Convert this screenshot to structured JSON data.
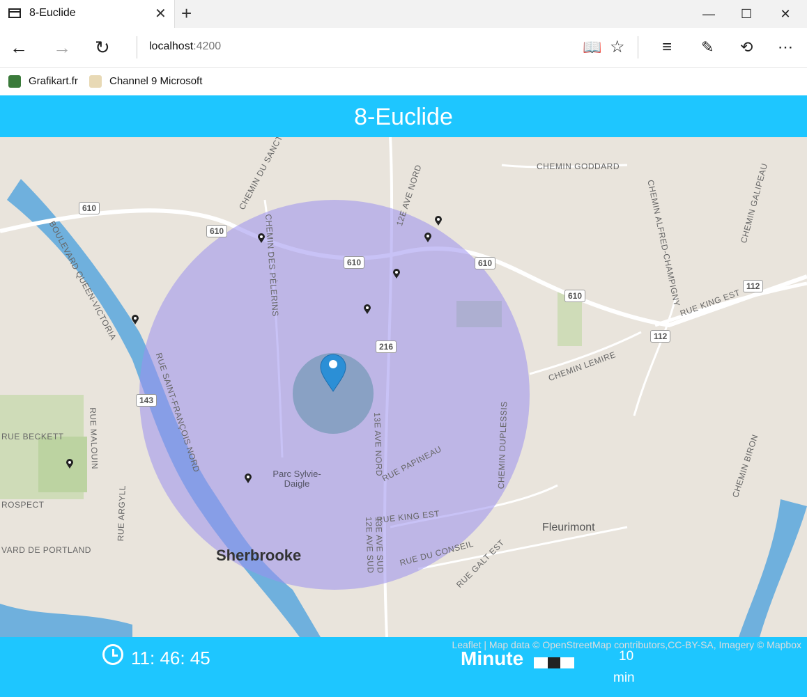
{
  "browser": {
    "tab_title": "8-Euclide",
    "tab_close": "✕",
    "new_tab": "+",
    "url_host": "localhost",
    "url_port": ":4200",
    "window_buttons": {
      "minimize": "—",
      "maximize": "☐",
      "close": "✕"
    },
    "favorites": [
      "Grafikart.fr",
      "Channel 9 Microsoft"
    ]
  },
  "app": {
    "title": "8-Euclide",
    "clock": "11: 46: 45",
    "minute_label": "Minute",
    "minute_value": "10",
    "minute_unit": "min",
    "minute_slider_level": 0.55
  },
  "map": {
    "attribution": "Leaflet | Map data © OpenStreetMap contributors,CC-BY-SA, Imagery © Mapbox",
    "city": "Sherbrooke",
    "town": "Fleurimont",
    "park": "Parc Sylvie-Daigle",
    "road_labels": [
      "CHEMIN GODDARD",
      "CHEMIN DU SANCTUAIRE",
      "12E AVE NORD",
      "CHEMIN ALFRED-CHAMPIGNY",
      "CHEMIN GALIPEAU",
      "BOULEVARD QUEEN-VICTORIA",
      "CHEMIN DES PÈLERINS",
      "RUE KING EST",
      "CHEMIN LEMIRE",
      "RUE SAINT-FRANÇOIS NORD",
      "13E AVE NORD",
      "CHEMIN DUPLESSIS",
      "RUE PAPINEAU",
      "RUE BECKETT",
      "RUE MALOUIN",
      "CHEMIN BIRON",
      "ROSPECT",
      "RUE ARGYLL",
      "VARD DE PORTLAND",
      "RUE KING EST",
      "12E AVE SUD",
      "13E AVE SUD",
      "RUE DU CONSEIL",
      "RUE GALT EST"
    ],
    "shields": [
      "610",
      "610",
      "610",
      "610",
      "610",
      "216",
      "143",
      "112",
      "112"
    ],
    "colors": {
      "circle": "#9b8fef",
      "center": "#5d8fa8",
      "marker": "#2b8fd6",
      "header": "#1ec6ff"
    }
  }
}
